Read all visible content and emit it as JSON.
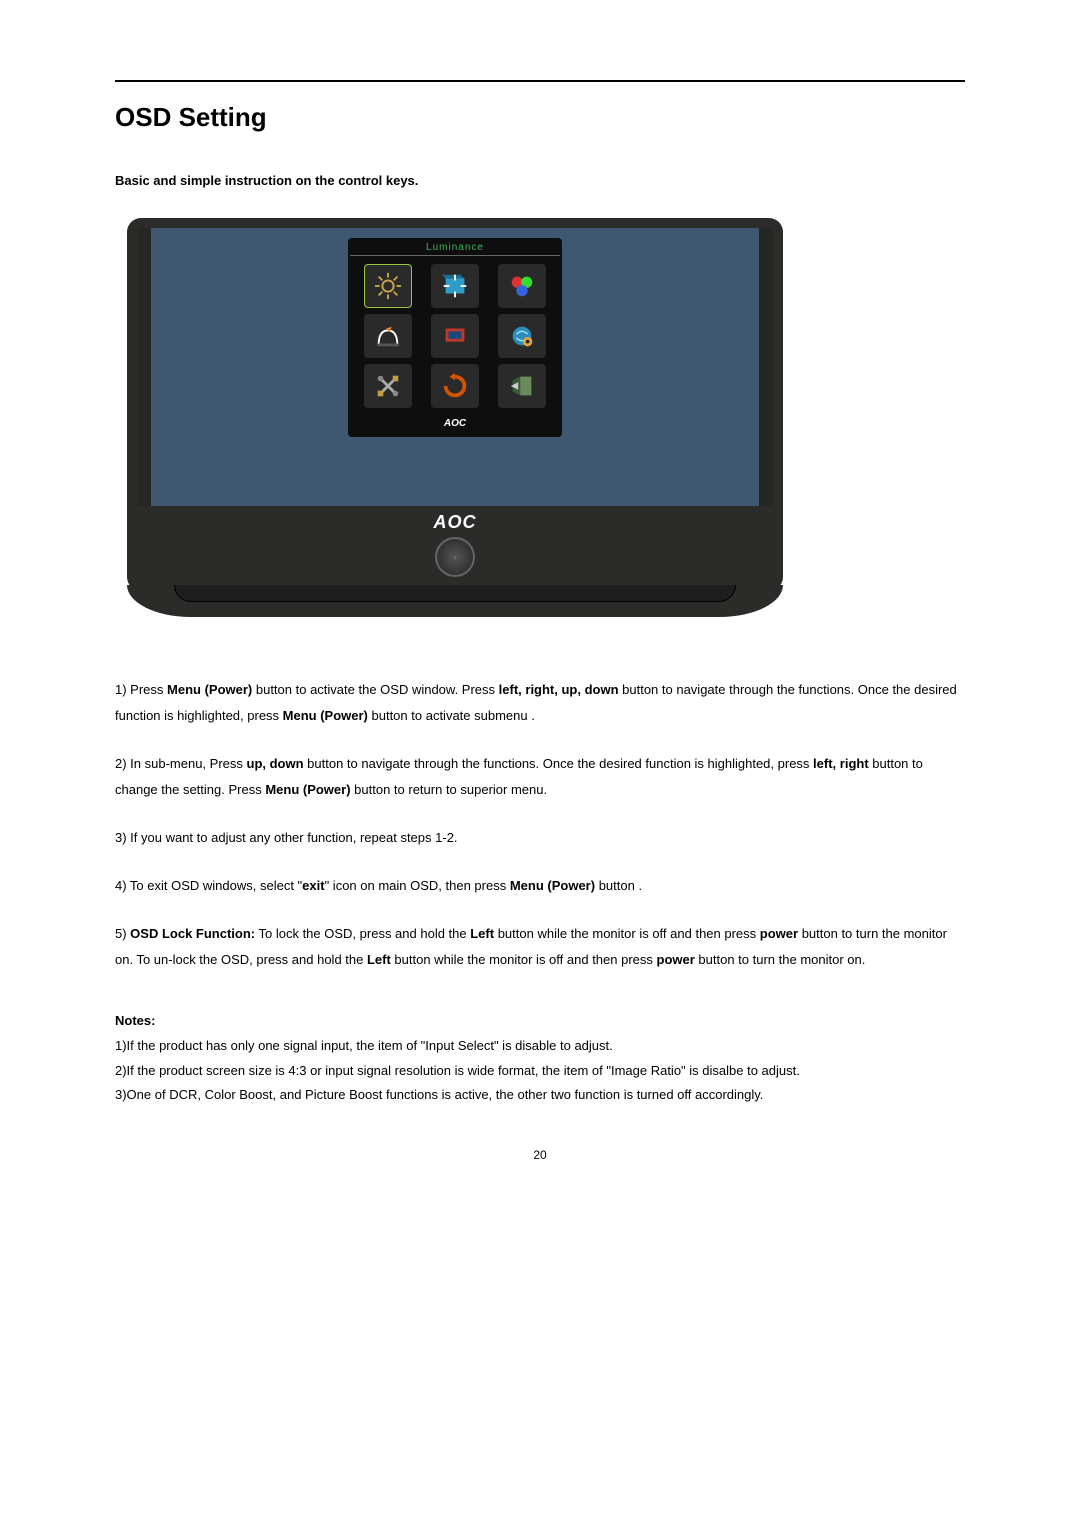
{
  "title": "OSD Setting",
  "intro": "Basic and simple instruction on the control keys.",
  "osd": {
    "title": "Luminance",
    "brand": "AOC",
    "icons": [
      {
        "name": "luminance-icon",
        "selected": true
      },
      {
        "name": "image-setup-icon",
        "selected": false
      },
      {
        "name": "color-temp-icon",
        "selected": false
      },
      {
        "name": "color-boost-icon",
        "selected": false
      },
      {
        "name": "picture-boost-icon",
        "selected": false
      },
      {
        "name": "osd-setup-icon",
        "selected": false
      },
      {
        "name": "extra-icon",
        "selected": false
      },
      {
        "name": "reset-icon",
        "selected": false
      },
      {
        "name": "exit-icon",
        "selected": false
      }
    ]
  },
  "bezel_brand": "AOC",
  "steps": {
    "s1_a": "1) Press ",
    "s1_b": "Menu (Power)",
    "s1_c": " button to activate the OSD window. Press ",
    "s1_d": "left, right, up, down",
    "s1_e": " button to navigate through the functions. Once the desired function is highlighted, press ",
    "s1_f": "Menu (Power)",
    "s1_g": " button to activate submenu .",
    "s2_a": "2) In sub-menu, Press ",
    "s2_b": "up, down",
    "s2_c": " button to navigate through the functions. Once the desired function is highlighted, press ",
    "s2_d": "left, right",
    "s2_e": " button to change the setting. Press ",
    "s2_f": "Menu (Power)",
    "s2_g": " button to return to superior menu.",
    "s3": "3) If you want to adjust any other function, repeat steps 1-2.",
    "s4_a": "4) To exit OSD windows, select \"",
    "s4_b": "exit",
    "s4_c": "\" icon on main OSD, then press ",
    "s4_d": "Menu (Power)",
    "s4_e": " button .",
    "s5_a": "5) ",
    "s5_b": "OSD Lock Function:",
    "s5_c": " To lock the OSD, press and hold the ",
    "s5_d": "Left",
    "s5_e": " button while the monitor is off and then press ",
    "s5_f": "power",
    "s5_g": " button to turn the monitor on. To un-lock the OSD, press and hold the ",
    "s5_h": "Left",
    "s5_i": " button while the monitor is off and then press ",
    "s5_j": "power",
    "s5_k": " button to turn the monitor on."
  },
  "notes": {
    "heading": "Notes:",
    "n1": "1)If the product has only one signal input, the item of \"Input Select\" is disable to adjust.",
    "n2": "2)If the product screen size is 4:3 or input signal resolution is wide format, the item of \"Image Ratio\" is disalbe to adjust.",
    "n3": "3)One of DCR, Color Boost, and Picture Boost functions is active, the other two function is turned off accordingly."
  },
  "page_number": "20"
}
